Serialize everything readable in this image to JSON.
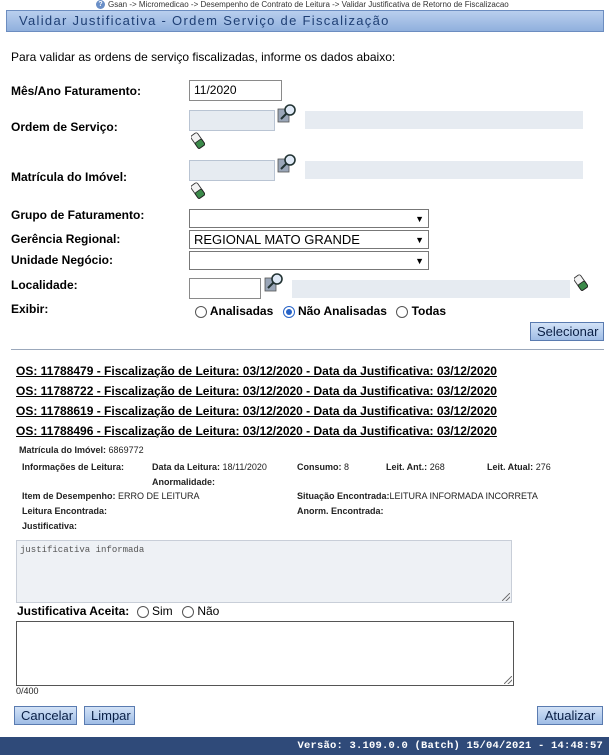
{
  "breadcrumb": "Gsan -> Micromedicao -> Desempenho de Contrato de Leitura -> Validar Justificativa de Retorno de Fiscalizacao",
  "title": "Validar Justificativa - Ordem Serviço de Fiscalização",
  "intro": "Para validar as ordens de serviço fiscalizadas, informe os dados abaixo:",
  "form": {
    "mes_ano_label": "Mês/Ano Faturamento:",
    "mes_ano_value": "11/2020",
    "ordem_servico_label": "Ordem de Serviço:",
    "matricula_label": "Matrícula do Imóvel:",
    "grupo_label": "Grupo de Faturamento:",
    "grupo_value": "",
    "gerencia_label": "Gerência Regional:",
    "gerencia_value": "REGIONAL MATO GRANDE",
    "unidade_label": "Unidade Negócio:",
    "unidade_value": "",
    "localidade_label": "Localidade:",
    "exibir_label": "Exibir:",
    "exibir_options": [
      "Analisadas",
      "Não Analisadas",
      "Todas"
    ],
    "exibir_selected": "Não Analisadas",
    "selecionar_label": "Selecionar"
  },
  "os_list": [
    "OS: 11788479 - Fiscalização de Leitura: 03/12/2020 - Data da Justificativa: 03/12/2020",
    "OS: 11788722 - Fiscalização de Leitura: 03/12/2020 - Data da Justificativa: 03/12/2020",
    "OS: 11788619 - Fiscalização de Leitura: 03/12/2020 - Data da Justificativa: 03/12/2020",
    "OS: 11788496 - Fiscalização de Leitura: 03/12/2020 - Data da Justificativa: 03/12/2020"
  ],
  "details": {
    "matricula_label": "Matrícula do Imóvel:",
    "matricula_value": "6869772",
    "info_leitura_label": "Informações de Leitura:",
    "data_leitura_label": "Data da Leitura:",
    "data_leitura_value": "18/11/2020",
    "consumo_label": "Consumo:",
    "consumo_value": "8",
    "leit_ant_label": "Leit. Ant.:",
    "leit_ant_value": "268",
    "leit_atual_label": "Leit. Atual:",
    "leit_atual_value": "276",
    "anormalidade_label": "Anormalidade:",
    "item_desempenho_label": "Item de Desempenho:",
    "item_desempenho_value": "ERRO DE LEITURA",
    "situacao_label": "Situação Encontrada:",
    "situacao_value": "LEITURA INFORMADA INCORRETA",
    "leitura_encontrada_label": "Leitura Encontrada:",
    "anorm_encontrada_label": "Anorm. Encontrada:",
    "justificativa_label": "Justificativa:",
    "justificativa_text": "justificativa informada"
  },
  "aceita": {
    "label": "Justificativa Aceita:",
    "options": [
      "Sim",
      "Não"
    ],
    "counter": "0/400"
  },
  "buttons": {
    "cancelar": "Cancelar",
    "limpar": "Limpar",
    "atualizar": "Atualizar"
  },
  "footer": "Versão: 3.109.0.0 (Batch) 15/04/2021 - 14:48:57"
}
